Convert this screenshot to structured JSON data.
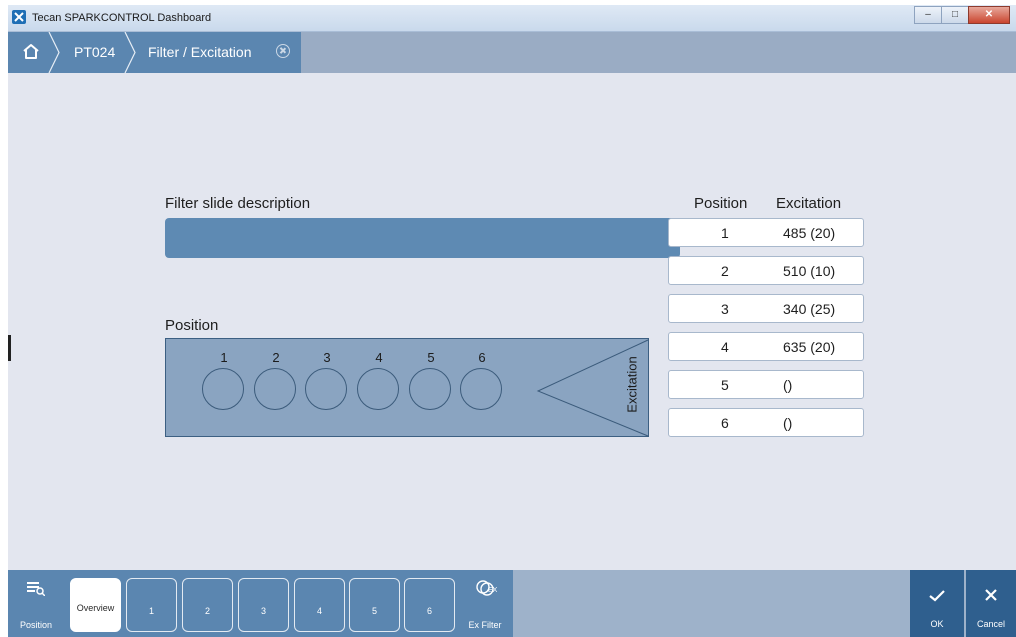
{
  "window": {
    "title": "Tecan SPARKCONTROL Dashboard"
  },
  "breadcrumb": {
    "items": [
      "PT024",
      "Filter / Excitation"
    ]
  },
  "filter_slide": {
    "description_label": "Filter slide description",
    "description_value": "",
    "position_label": "Position",
    "positions": [
      "1",
      "2",
      "3",
      "4",
      "5",
      "6"
    ],
    "excitation_label": "Excitation"
  },
  "table": {
    "headers": {
      "position": "Position",
      "excitation": "Excitation"
    },
    "rows": [
      {
        "position": "1",
        "excitation": "485 (20)"
      },
      {
        "position": "2",
        "excitation": "510 (10)"
      },
      {
        "position": "3",
        "excitation": "340 (25)"
      },
      {
        "position": "4",
        "excitation": "635 (20)"
      },
      {
        "position": "5",
        "excitation": "()"
      },
      {
        "position": "6",
        "excitation": "()"
      }
    ]
  },
  "toolbar": {
    "position_label": "Position",
    "overview_label": "Overview",
    "tabs": [
      "1",
      "2",
      "3",
      "4",
      "5",
      "6"
    ],
    "ex_filter_label": "Ex Filter",
    "ok_label": "OK",
    "cancel_label": "Cancel"
  },
  "colors": {
    "accent": "#5b86b0",
    "dark_accent": "#2f5f8e",
    "background": "#e3e6ef",
    "slide": "#8aa4c1"
  },
  "icons": {
    "home": "home-icon",
    "close": "close-circle-icon",
    "position": "list-icon",
    "ex_filter": "filter-ex-icon",
    "ok": "check-icon",
    "cancel": "x-icon"
  }
}
